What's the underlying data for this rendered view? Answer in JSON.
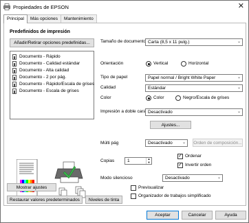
{
  "window": {
    "title": "Propiedades de EPSON",
    "close_glyph": "✕"
  },
  "tabs": [
    {
      "label": "Principal"
    },
    {
      "label": "Más opciones"
    },
    {
      "label": "Mantenimiento"
    }
  ],
  "presets": {
    "heading": "Predefinidos de impresión",
    "add_remove_button": "Añadir/Retirar opciones predefinidas...",
    "items": [
      "Documento - Rápido",
      "Documento - Calidad estándar",
      "Documento - Alta calidad",
      "Documento - 2 por pág.",
      "Documento - Rápido/Escala de grises",
      "Documento - Escala de grises"
    ]
  },
  "settings": {
    "doc_size_label": "Tamaño de documento",
    "doc_size_value": "Carta (8,5 x 11 pulg.)",
    "orientation_label": "Orientación",
    "orientation_vertical": "Vertical",
    "orientation_horizontal": "Horizontal",
    "paper_type_label": "Tipo de papel",
    "paper_type_value": "Papel normal / Bright White Paper",
    "quality_label": "Calidad",
    "quality_value": "Estándar",
    "color_label": "Color",
    "color_option": "Color",
    "grayscale_option": "Negro/Escala de grises",
    "duplex_label": "Impresión a doble cara",
    "duplex_value": "Desactivado",
    "adjust_button": "Ajustes...",
    "multipage_label": "Múlti pág",
    "multipage_value": "Desactivado",
    "page_order_button": "Orden de composición...",
    "copies_label": "Copias",
    "copies_value": "1",
    "collate_label": "Ordenar",
    "reverse_label": "Invertir orden",
    "quiet_label": "Modo silencioso",
    "quiet_value": "Desactivado",
    "preview_label": "Previsualizar",
    "job_arranger_label": "Organizador de trabajos simplificado"
  },
  "buttons": {
    "show_settings": "Mostrar ajustes",
    "restore_defaults": "Restaurar valores predeterminados",
    "ink_levels": "Niveles de tinta",
    "accept": "Aceptar",
    "cancel": "Cancelar",
    "help": "Ayuda"
  },
  "state": {
    "orientation": "vertical",
    "color_mode": "color",
    "collate": true,
    "reverse_order": true,
    "preview": false,
    "job_arranger": false
  },
  "colors": {
    "accent_border": "#0078d7",
    "check_mark": "✓",
    "dropdown_chevron": "⌄"
  }
}
